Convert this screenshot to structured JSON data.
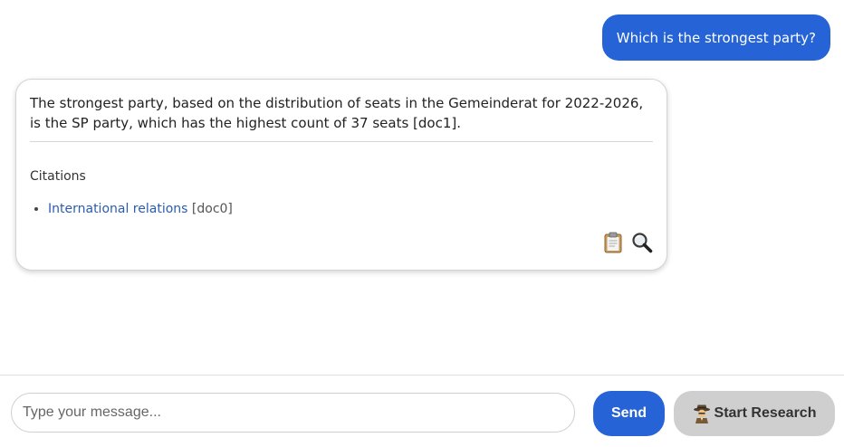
{
  "conversation": {
    "user_message": "Which is the strongest party?",
    "assistant": {
      "answer": "The strongest party, based on the distribution of seats in the Gemeinderat for 2022-2026, is the SP party, which has the highest count of 37 seats [doc1].",
      "citations_heading": "Citations",
      "citations": [
        {
          "title": "International relations",
          "ref": "[doc0]"
        }
      ],
      "actions": {
        "copy_icon": "clipboard-icon",
        "inspect_icon": "magnifier-icon"
      }
    }
  },
  "input_bar": {
    "placeholder": "Type your message...",
    "value": "",
    "send_label": "Send",
    "research_label": "Start Research",
    "research_icon": "detective-icon"
  },
  "colors": {
    "accent": "#2563d6",
    "research_button_bg": "#cfcfcf",
    "link": "#2a5db0"
  }
}
